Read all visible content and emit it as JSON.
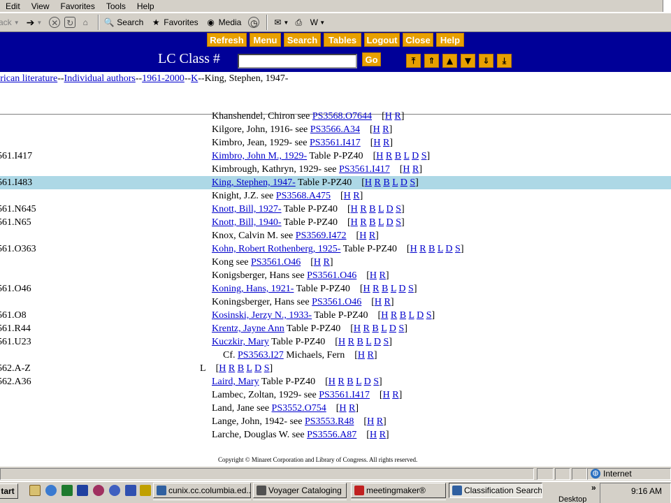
{
  "menu": [
    "Edit",
    "View",
    "Favorites",
    "Tools",
    "Help"
  ],
  "toolbar": {
    "back_label": "ack",
    "search_label": "Search",
    "favorites_label": "Favorites",
    "media_label": "Media"
  },
  "nav_buttons": [
    "Refresh",
    "Menu",
    "Search",
    "Tables",
    "Logout",
    "Close",
    "Help"
  ],
  "lc": {
    "label": "LC Class #",
    "value": "",
    "go_label": "Go"
  },
  "breadcrumb": {
    "links": [
      "erican literature",
      "Individual authors",
      "1961-2000",
      "K"
    ],
    "current": "King, Stephen, 1947-",
    "sep": "--"
  },
  "rows": [
    {
      "cls": "",
      "name": "Khanshendel, Chiron",
      "link": false,
      "mid": " see ",
      "ref": "PS3568.O7644",
      "opts": [
        "H",
        "R"
      ]
    },
    {
      "cls": "",
      "name": "Kilgore, John, 1916-",
      "link": false,
      "mid": " see ",
      "ref": "PS3566.A34",
      "opts": [
        "H",
        "R"
      ]
    },
    {
      "cls": "",
      "name": "Kimbro, Jean, 1929-",
      "link": false,
      "mid": " see ",
      "ref": "PS3561.I417",
      "opts": [
        "H",
        "R"
      ]
    },
    {
      "cls": "561.I417",
      "name": "Kimbro, John M., 1929-",
      "link": true,
      "mid": " Table P-PZ40",
      "ref": "",
      "opts": [
        "H",
        "R",
        "B",
        "L",
        "D",
        "S"
      ]
    },
    {
      "cls": "",
      "name": "Kimbrough, Kathryn, 1929-",
      "link": false,
      "mid": " see ",
      "ref": "PS3561.I417",
      "opts": [
        "H",
        "R"
      ]
    },
    {
      "cls": "561.I483",
      "name": "King, Stephen, 1947-",
      "link": true,
      "mid": " Table P-PZ40",
      "ref": "",
      "opts": [
        "H",
        "R",
        "B",
        "L",
        "D",
        "S"
      ],
      "highlight": true
    },
    {
      "cls": "",
      "name": "Knight, J.Z.",
      "link": false,
      "mid": " see ",
      "ref": "PS3568.A475",
      "opts": [
        "H",
        "R"
      ]
    },
    {
      "cls": "561.N645",
      "name": "Knott, Bill, 1927-",
      "link": true,
      "mid": " Table P-PZ40",
      "ref": "",
      "opts": [
        "H",
        "R",
        "B",
        "L",
        "D",
        "S"
      ]
    },
    {
      "cls": "561.N65",
      "name": "Knott, Bill, 1940-",
      "link": true,
      "mid": " Table P-PZ40",
      "ref": "",
      "opts": [
        "H",
        "R",
        "B",
        "L",
        "D",
        "S"
      ]
    },
    {
      "cls": "",
      "name": "Knox, Calvin M.",
      "link": false,
      "mid": " see ",
      "ref": "PS3569.I472",
      "opts": [
        "H",
        "R"
      ]
    },
    {
      "cls": "561.O363",
      "name": "Kohn, Robert Rothenberg, 1925-",
      "link": true,
      "mid": " Table P-PZ40",
      "ref": "",
      "opts": [
        "H",
        "R",
        "B",
        "L",
        "D",
        "S"
      ]
    },
    {
      "cls": "",
      "name": "Kong",
      "link": false,
      "mid": " see ",
      "ref": "PS3561.O46",
      "opts": [
        "H",
        "R"
      ]
    },
    {
      "cls": "",
      "name": "Konigsberger, Hans",
      "link": false,
      "mid": " see ",
      "ref": "PS3561.O46",
      "opts": [
        "H",
        "R"
      ]
    },
    {
      "cls": "561.O46",
      "name": "Koning, Hans, 1921-",
      "link": true,
      "mid": " Table P-PZ40",
      "ref": "",
      "opts": [
        "H",
        "R",
        "B",
        "L",
        "D",
        "S"
      ]
    },
    {
      "cls": "",
      "name": "Koningsberger, Hans",
      "link": false,
      "mid": " see ",
      "ref": "PS3561.O46",
      "opts": [
        "H",
        "R"
      ]
    },
    {
      "cls": "561.O8",
      "name": "Kosinski, Jerzy N., 1933-",
      "link": true,
      "mid": " Table P-PZ40",
      "ref": "",
      "opts": [
        "H",
        "R",
        "B",
        "L",
        "D",
        "S"
      ]
    },
    {
      "cls": "561.R44",
      "name": "Krentz, Jayne Ann",
      "link": true,
      "mid": " Table P-PZ40",
      "ref": "",
      "opts": [
        "H",
        "R",
        "B",
        "L",
        "D",
        "S"
      ]
    },
    {
      "cls": "561.U23",
      "name": "Kuczkir, Mary",
      "link": true,
      "mid": " Table P-PZ40",
      "ref": "",
      "opts": [
        "H",
        "R",
        "B",
        "L",
        "D",
        "S"
      ]
    },
    {
      "cls": "",
      "name": "",
      "link": false,
      "mid": "Michaels, Fern",
      "ref": "PS3563.I27",
      "opts": [
        "H",
        "R"
      ],
      "cf": true,
      "cf_label": "Cf."
    },
    {
      "cls": "562.A-Z",
      "name": "L",
      "link": false,
      "mid": "",
      "ref": "",
      "opts": [
        "H",
        "R",
        "B",
        "L",
        "D",
        "S"
      ],
      "letter": true
    },
    {
      "cls": "562.A36",
      "name": "Laird, Mary",
      "link": true,
      "mid": " Table P-PZ40",
      "ref": "",
      "opts": [
        "H",
        "R",
        "B",
        "L",
        "D",
        "S"
      ]
    },
    {
      "cls": "",
      "name": "Lambec, Zoltan, 1929-",
      "link": false,
      "mid": " see ",
      "ref": "PS3561.I417",
      "opts": [
        "H",
        "R"
      ]
    },
    {
      "cls": "",
      "name": "Land, Jane",
      "link": false,
      "mid": " see ",
      "ref": "PS3552.O754",
      "opts": [
        "H",
        "R"
      ]
    },
    {
      "cls": "",
      "name": "Lange, John, 1942-",
      "link": false,
      "mid": " see ",
      "ref": "PS3553.R48",
      "opts": [
        "H",
        "R"
      ]
    },
    {
      "cls": "",
      "name": "Larche, Douglas W.",
      "link": false,
      "mid": " see ",
      "ref": "PS3556.A87",
      "opts": [
        "H",
        "R"
      ]
    }
  ],
  "copyright": "Copyright © Minaret Corporation and Library of Congress. All rights reserved.",
  "status": {
    "zone": "Internet"
  },
  "taskbar": {
    "start": "tart",
    "tasks": [
      "cunix.cc.columbia.ed...",
      "Voyager Cataloging",
      "meetingmaker®",
      "Classification Search ..."
    ],
    "desktop": "Desktop",
    "chevron": "»",
    "time": "9:16 AM"
  }
}
